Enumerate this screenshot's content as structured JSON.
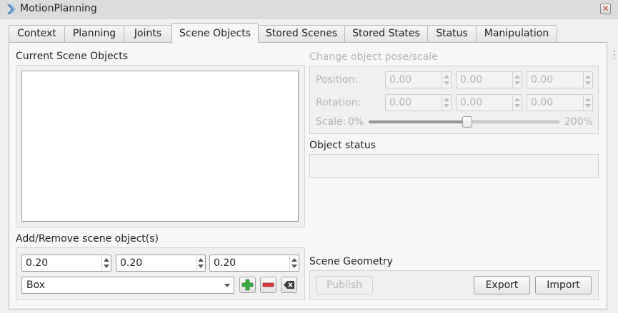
{
  "window": {
    "title": "MotionPlanning",
    "close_glyph": "✕"
  },
  "tabs": [
    {
      "label": "Context",
      "active": false
    },
    {
      "label": "Planning",
      "active": false
    },
    {
      "label": "Joints",
      "active": false
    },
    {
      "label": "Scene Objects",
      "active": true
    },
    {
      "label": "Stored Scenes",
      "active": false
    },
    {
      "label": "Stored States",
      "active": false
    },
    {
      "label": "Status",
      "active": false
    },
    {
      "label": "Manipulation",
      "active": false
    }
  ],
  "scene_objects": {
    "current_title": "Current Scene Objects",
    "items": []
  },
  "pose": {
    "title": "Change object pose/scale",
    "position_label": "Position:",
    "rotation_label": "Rotation:",
    "position": [
      "0.00",
      "0.00",
      "0.00"
    ],
    "rotation": [
      "0.00",
      "0.00",
      "0.00"
    ],
    "scale_label": "Scale:",
    "scale_min": "0%",
    "scale_max": "200%",
    "scale_value_fraction": 0.5
  },
  "object_status": {
    "title": "Object status",
    "text": ""
  },
  "add_remove": {
    "title": "Add/Remove scene object(s)",
    "dims": [
      "0.20",
      "0.20",
      "0.20"
    ],
    "shape": "Box",
    "add_icon": "plus-icon",
    "remove_icon": "minus-icon",
    "clear_icon": "clear-icon"
  },
  "scene_geometry": {
    "title": "Scene Geometry",
    "publish_label": "Publish",
    "export_label": "Export",
    "import_label": "Import"
  },
  "colors": {
    "add_icon": "#3cb043",
    "remove_icon": "#d83a3a",
    "logo": "#3d7fc4"
  }
}
